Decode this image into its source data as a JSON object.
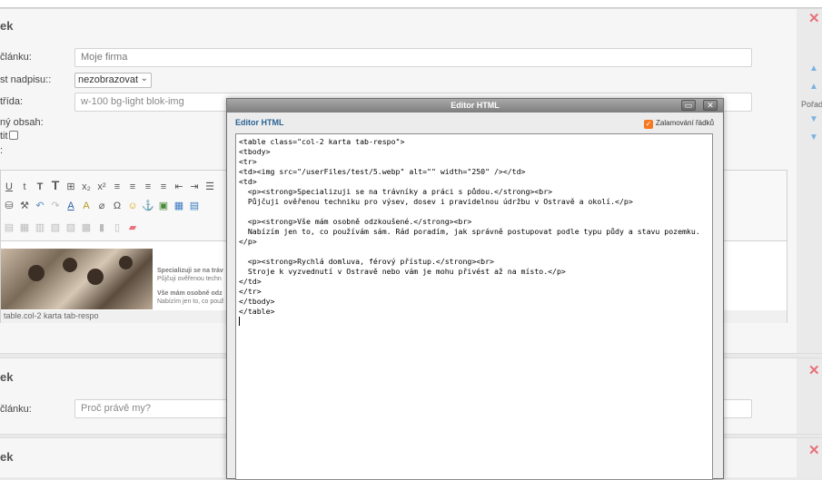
{
  "panel1": {
    "title": "ek",
    "title_label": "článku:",
    "title_value": "Moje firma",
    "heading_label": "st nadpisu::",
    "heading_select": "nezobrazovat",
    "class_label": "třída:",
    "class_value": "w-100 bg-light blok-img",
    "content_label": "ný obsah:",
    "checkbox_label": "tit",
    "colon": ":",
    "thumb_line1": "Specializuji se na tráv",
    "thumb_line2": "Půjčuji ověřenou techn",
    "thumb_line3": "Vše mám osobně odz",
    "thumb_line4": "Nabízím jen to, co použ",
    "path": "table.col-2 karta tab-respo"
  },
  "panel2": {
    "title": "ek",
    "title_label": "článku:",
    "placeholder": "Proč právě my?"
  },
  "panel3": {
    "title": "ek"
  },
  "rail": {
    "order_label": "Pořad"
  },
  "toolbar": {
    "row1": [
      "U",
      "t",
      "T",
      "T",
      "⊞",
      "x₂",
      "x²",
      "≡",
      "≡",
      "≡",
      "≡",
      "⇤",
      "⇥",
      "☰"
    ],
    "row2": [
      "⛁",
      "⚒",
      "↶",
      "↷",
      "A",
      "A",
      "⌀",
      "Ω",
      "☺",
      "⚓",
      "▣",
      "▦",
      "▤"
    ],
    "row3": [
      "▤",
      "▦",
      "▥",
      "▧",
      "▨",
      "▩",
      "▮",
      "▯",
      "▰"
    ]
  },
  "dialog": {
    "title": "Editor HTML",
    "label": "Editor HTML",
    "wrap_label": "Zalamování řádků",
    "wrap_checked": true,
    "maximize": "▭",
    "close": "✕",
    "code": "<table class=\"col-2 karta tab-respo\">\n<tbody>\n<tr>\n<td><img src=\"/userFiles/test/5.webp\" alt=\"\" width=\"250\" /></td>\n<td>\n  <p><strong>Specializuji se na trávníky a práci s půdou.</strong><br>\n  Půjčuji ověřenou techniku pro výsev, dosev i pravidelnou údržbu v Ostravě a okolí.</p>\n\n  <p><strong>Vše mám osobně odzkoušené.</strong><br>\n  Nabízím jen to, co používám sám. Rád poradím, jak správně postupovat podle typu půdy a stavu pozemku.</p>\n\n  <p><strong>Rychlá domluva, férový přístup.</strong><br>\n  Stroje k vyzvednutí v Ostravě nebo vám je mohu přivést až na místo.</p>\n</td>\n</tr>\n</tbody>\n</table>\n"
  },
  "colors": {
    "close_red": "#e9707a",
    "arrow_blue": "#7ab2e0",
    "wrap_orange": "#f47920",
    "label_blue": "#2a6496"
  }
}
